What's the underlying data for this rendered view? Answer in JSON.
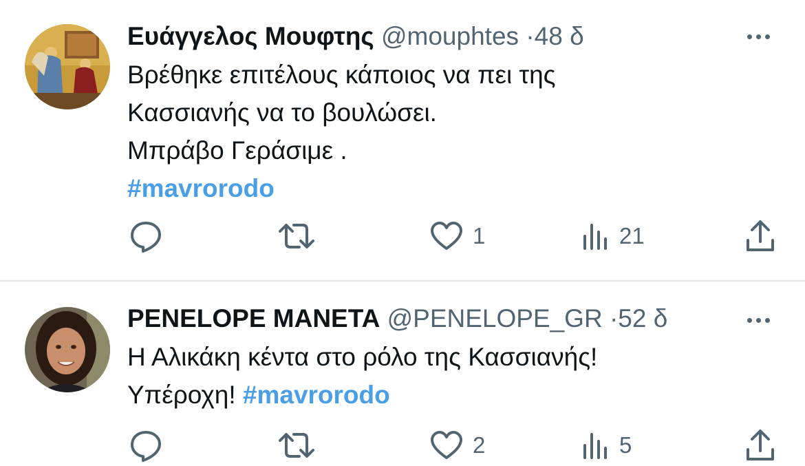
{
  "tweets": [
    {
      "author_name": "Ευάγγελος Μουφτης",
      "handle": "@mouphtes",
      "separator": "·",
      "time": "48 δ",
      "lines": [
        "Βρέθηκε επιτέλους κάποιος να πει της",
        "Κασσιανής να το βουλώσει.",
        "Μπράβο Γεράσιμε ."
      ],
      "hashtag": "#mavrorodo",
      "likes": "1",
      "views": "21",
      "avatar_icon": "annunciation-icon-painting"
    },
    {
      "author_name": "PENELOPE MANETA",
      "handle": "@PENELOPE_GR",
      "separator": "·",
      "time": "52 δ",
      "line1": "Η Αλικάκη κέντα στο ρόλο της Κασσιανής!",
      "line2_prefix": "Υπέροχη! ",
      "hashtag": "#mavrorodo",
      "likes": "2",
      "views": "5",
      "avatar_icon": "profile-photo-woman"
    }
  ],
  "colors": {
    "text": "#0f1419",
    "muted": "#536471",
    "hashtag": "#4a9ee6",
    "divider": "#e4e7ea"
  },
  "icons": [
    "reply-icon",
    "retweet-icon",
    "like-icon",
    "views-icon",
    "share-icon",
    "more-icon"
  ]
}
